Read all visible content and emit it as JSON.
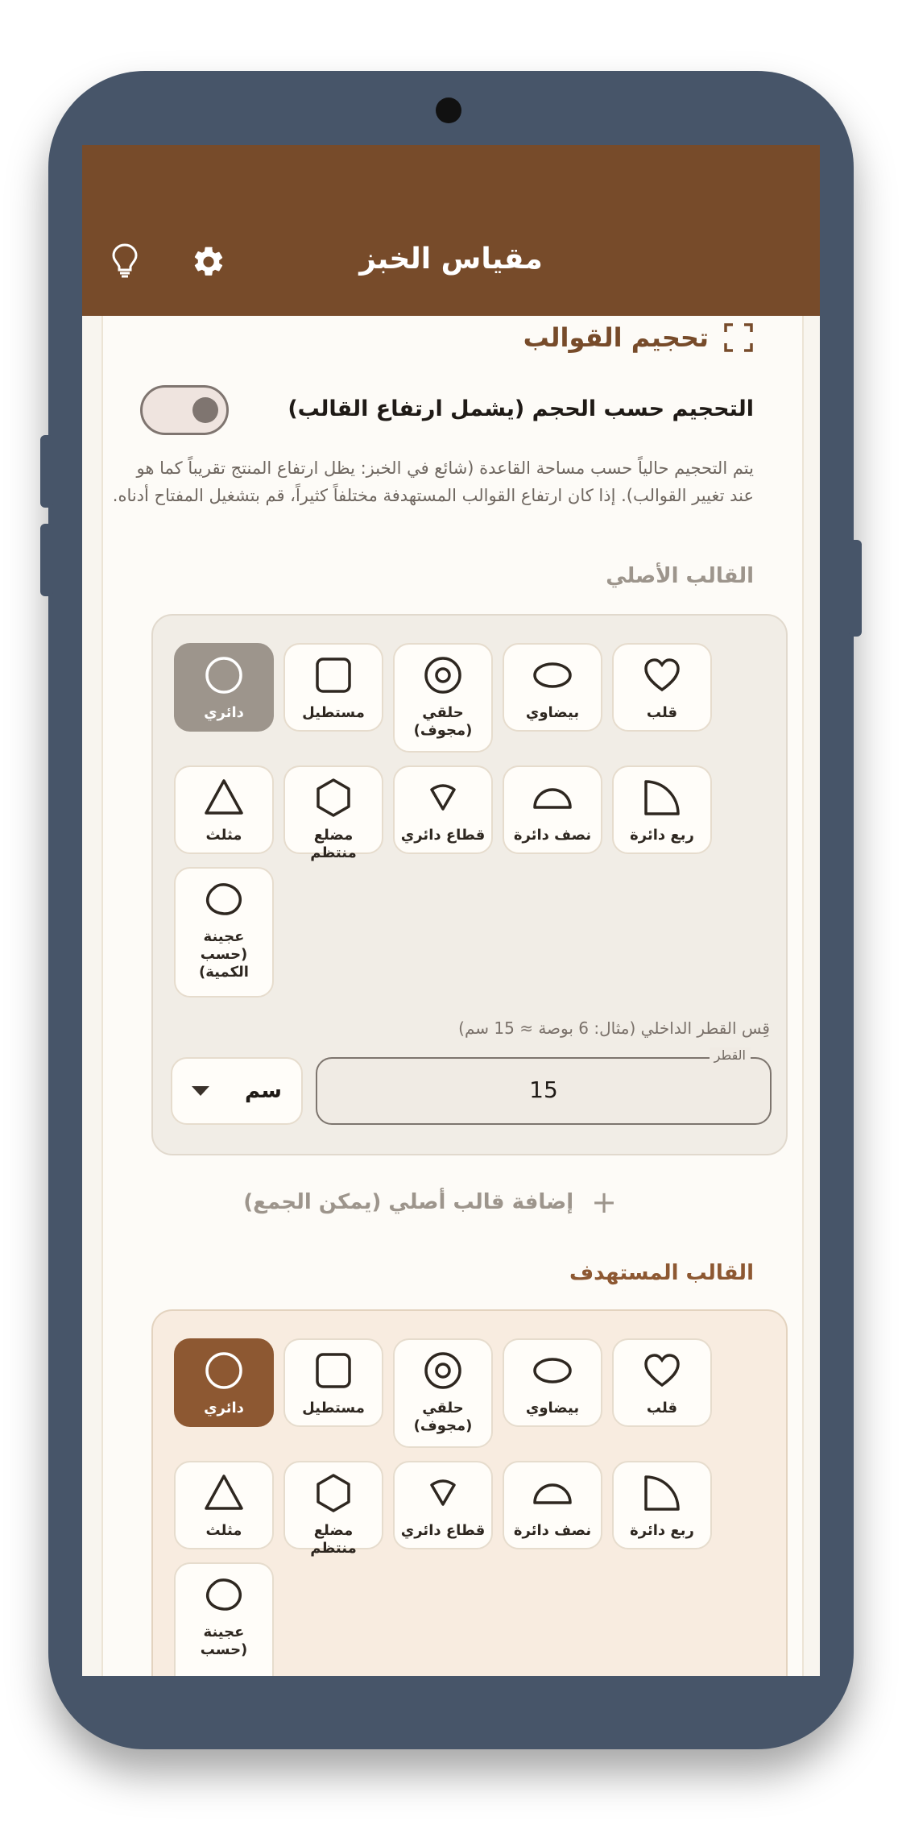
{
  "app": {
    "title": "مقياس الخبز"
  },
  "appbar_icons": [
    "lightbulb-icon",
    "gear-icon"
  ],
  "section": {
    "title": "تحجيم القوالب",
    "icon": "fullscreen-icon",
    "volume_toggle_label": "التحجيم حسب الحجم (يشمل ارتفاع القالب)",
    "volume_toggle_on": false,
    "description": "يتم التحجيم حالياً حسب مساحة القاعدة (شائع في الخبز: يظل ارتفاع المنتج تقريباً كما هو عند تغيير القوالب). إذا كان ارتفاع القوالب المستهدفة مختلفاً كثيراً، قم بتشغيل المفتاح أدناه."
  },
  "original_pan": {
    "label": "القالب الأصلي",
    "selected": "circle",
    "shapes": [
      {
        "id": "circle",
        "label": "دائري"
      },
      {
        "id": "rectangle",
        "label": "مستطيل"
      },
      {
        "id": "ring",
        "label": "حلقي (مجوف)"
      },
      {
        "id": "oval",
        "label": "بيضاوي"
      },
      {
        "id": "heart",
        "label": "قلب"
      },
      {
        "id": "triangle",
        "label": "مثلث"
      },
      {
        "id": "hexagon",
        "label": "مضلع منتظم"
      },
      {
        "id": "sector",
        "label": "قطاع دائري"
      },
      {
        "id": "semicircle",
        "label": "نصف دائرة"
      },
      {
        "id": "quarter",
        "label": "ربع دائرة"
      },
      {
        "id": "dough",
        "label": "عجينة (حسب الكمية)"
      }
    ],
    "hint": "قِس القطر الداخلي (مثال: 6 بوصة ≈ 15 سم)",
    "diameter_label": "القطر",
    "diameter_value": "15",
    "unit": "سم"
  },
  "add_original": {
    "label": "إضافة قالب أصلي (يمكن الجمع)"
  },
  "target_pan": {
    "label": "القالب المستهدف",
    "selected": "circle",
    "shapes": [
      {
        "id": "circle",
        "label": "دائري"
      },
      {
        "id": "rectangle",
        "label": "مستطيل"
      },
      {
        "id": "ring",
        "label": "حلقي (مجوف)"
      },
      {
        "id": "oval",
        "label": "بيضاوي"
      },
      {
        "id": "heart",
        "label": "قلب"
      },
      {
        "id": "triangle",
        "label": "مثلث"
      },
      {
        "id": "hexagon",
        "label": "مضلع منتظم"
      },
      {
        "id": "sector",
        "label": "قطاع دائري"
      },
      {
        "id": "semicircle",
        "label": "نصف دائرة"
      },
      {
        "id": "quarter",
        "label": "ربع دائرة"
      },
      {
        "id": "dough",
        "label": "عجينة (حسب"
      }
    ]
  },
  "colors": {
    "appbar": "#774b2a",
    "accent_brown": "#8d5832",
    "selected_grey": "#9d958c",
    "frame": "#475569"
  }
}
